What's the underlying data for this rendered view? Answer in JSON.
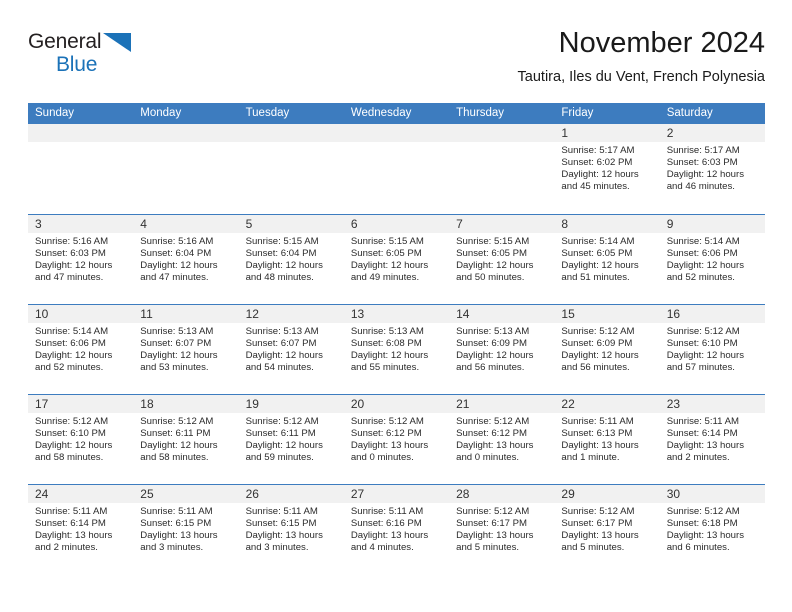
{
  "brand": {
    "name_top": "General",
    "name_bottom": "Blue",
    "triangle_icon": "triangle-icon",
    "color_dark": "#231f20",
    "color_blue": "#1b72b8"
  },
  "header": {
    "title": "November 2024",
    "subtitle": "Tautira, Iles du Vent, French Polynesia"
  },
  "theme": {
    "accent": "#3d7cbf",
    "day_strip": "#f1f1f1",
    "text": "#2b2b2b"
  },
  "calendar": {
    "weekdays": [
      "Sunday",
      "Monday",
      "Tuesday",
      "Wednesday",
      "Thursday",
      "Friday",
      "Saturday"
    ],
    "weeks": [
      [
        {
          "day": "",
          "empty": true
        },
        {
          "day": "",
          "empty": true
        },
        {
          "day": "",
          "empty": true
        },
        {
          "day": "",
          "empty": true
        },
        {
          "day": "",
          "empty": true
        },
        {
          "day": "1",
          "sunrise": "Sunrise: 5:17 AM",
          "sunset": "Sunset: 6:02 PM",
          "daylight1": "Daylight: 12 hours",
          "daylight2": "and 45 minutes."
        },
        {
          "day": "2",
          "sunrise": "Sunrise: 5:17 AM",
          "sunset": "Sunset: 6:03 PM",
          "daylight1": "Daylight: 12 hours",
          "daylight2": "and 46 minutes."
        }
      ],
      [
        {
          "day": "3",
          "sunrise": "Sunrise: 5:16 AM",
          "sunset": "Sunset: 6:03 PM",
          "daylight1": "Daylight: 12 hours",
          "daylight2": "and 47 minutes."
        },
        {
          "day": "4",
          "sunrise": "Sunrise: 5:16 AM",
          "sunset": "Sunset: 6:04 PM",
          "daylight1": "Daylight: 12 hours",
          "daylight2": "and 47 minutes."
        },
        {
          "day": "5",
          "sunrise": "Sunrise: 5:15 AM",
          "sunset": "Sunset: 6:04 PM",
          "daylight1": "Daylight: 12 hours",
          "daylight2": "and 48 minutes."
        },
        {
          "day": "6",
          "sunrise": "Sunrise: 5:15 AM",
          "sunset": "Sunset: 6:05 PM",
          "daylight1": "Daylight: 12 hours",
          "daylight2": "and 49 minutes."
        },
        {
          "day": "7",
          "sunrise": "Sunrise: 5:15 AM",
          "sunset": "Sunset: 6:05 PM",
          "daylight1": "Daylight: 12 hours",
          "daylight2": "and 50 minutes."
        },
        {
          "day": "8",
          "sunrise": "Sunrise: 5:14 AM",
          "sunset": "Sunset: 6:05 PM",
          "daylight1": "Daylight: 12 hours",
          "daylight2": "and 51 minutes."
        },
        {
          "day": "9",
          "sunrise": "Sunrise: 5:14 AM",
          "sunset": "Sunset: 6:06 PM",
          "daylight1": "Daylight: 12 hours",
          "daylight2": "and 52 minutes."
        }
      ],
      [
        {
          "day": "10",
          "sunrise": "Sunrise: 5:14 AM",
          "sunset": "Sunset: 6:06 PM",
          "daylight1": "Daylight: 12 hours",
          "daylight2": "and 52 minutes."
        },
        {
          "day": "11",
          "sunrise": "Sunrise: 5:13 AM",
          "sunset": "Sunset: 6:07 PM",
          "daylight1": "Daylight: 12 hours",
          "daylight2": "and 53 minutes."
        },
        {
          "day": "12",
          "sunrise": "Sunrise: 5:13 AM",
          "sunset": "Sunset: 6:07 PM",
          "daylight1": "Daylight: 12 hours",
          "daylight2": "and 54 minutes."
        },
        {
          "day": "13",
          "sunrise": "Sunrise: 5:13 AM",
          "sunset": "Sunset: 6:08 PM",
          "daylight1": "Daylight: 12 hours",
          "daylight2": "and 55 minutes."
        },
        {
          "day": "14",
          "sunrise": "Sunrise: 5:13 AM",
          "sunset": "Sunset: 6:09 PM",
          "daylight1": "Daylight: 12 hours",
          "daylight2": "and 56 minutes."
        },
        {
          "day": "15",
          "sunrise": "Sunrise: 5:12 AM",
          "sunset": "Sunset: 6:09 PM",
          "daylight1": "Daylight: 12 hours",
          "daylight2": "and 56 minutes."
        },
        {
          "day": "16",
          "sunrise": "Sunrise: 5:12 AM",
          "sunset": "Sunset: 6:10 PM",
          "daylight1": "Daylight: 12 hours",
          "daylight2": "and 57 minutes."
        }
      ],
      [
        {
          "day": "17",
          "sunrise": "Sunrise: 5:12 AM",
          "sunset": "Sunset: 6:10 PM",
          "daylight1": "Daylight: 12 hours",
          "daylight2": "and 58 minutes."
        },
        {
          "day": "18",
          "sunrise": "Sunrise: 5:12 AM",
          "sunset": "Sunset: 6:11 PM",
          "daylight1": "Daylight: 12 hours",
          "daylight2": "and 58 minutes."
        },
        {
          "day": "19",
          "sunrise": "Sunrise: 5:12 AM",
          "sunset": "Sunset: 6:11 PM",
          "daylight1": "Daylight: 12 hours",
          "daylight2": "and 59 minutes."
        },
        {
          "day": "20",
          "sunrise": "Sunrise: 5:12 AM",
          "sunset": "Sunset: 6:12 PM",
          "daylight1": "Daylight: 13 hours",
          "daylight2": "and 0 minutes."
        },
        {
          "day": "21",
          "sunrise": "Sunrise: 5:12 AM",
          "sunset": "Sunset: 6:12 PM",
          "daylight1": "Daylight: 13 hours",
          "daylight2": "and 0 minutes."
        },
        {
          "day": "22",
          "sunrise": "Sunrise: 5:11 AM",
          "sunset": "Sunset: 6:13 PM",
          "daylight1": "Daylight: 13 hours",
          "daylight2": "and 1 minute."
        },
        {
          "day": "23",
          "sunrise": "Sunrise: 5:11 AM",
          "sunset": "Sunset: 6:14 PM",
          "daylight1": "Daylight: 13 hours",
          "daylight2": "and 2 minutes."
        }
      ],
      [
        {
          "day": "24",
          "sunrise": "Sunrise: 5:11 AM",
          "sunset": "Sunset: 6:14 PM",
          "daylight1": "Daylight: 13 hours",
          "daylight2": "and 2 minutes."
        },
        {
          "day": "25",
          "sunrise": "Sunrise: 5:11 AM",
          "sunset": "Sunset: 6:15 PM",
          "daylight1": "Daylight: 13 hours",
          "daylight2": "and 3 minutes."
        },
        {
          "day": "26",
          "sunrise": "Sunrise: 5:11 AM",
          "sunset": "Sunset: 6:15 PM",
          "daylight1": "Daylight: 13 hours",
          "daylight2": "and 3 minutes."
        },
        {
          "day": "27",
          "sunrise": "Sunrise: 5:11 AM",
          "sunset": "Sunset: 6:16 PM",
          "daylight1": "Daylight: 13 hours",
          "daylight2": "and 4 minutes."
        },
        {
          "day": "28",
          "sunrise": "Sunrise: 5:12 AM",
          "sunset": "Sunset: 6:17 PM",
          "daylight1": "Daylight: 13 hours",
          "daylight2": "and 5 minutes."
        },
        {
          "day": "29",
          "sunrise": "Sunrise: 5:12 AM",
          "sunset": "Sunset: 6:17 PM",
          "daylight1": "Daylight: 13 hours",
          "daylight2": "and 5 minutes."
        },
        {
          "day": "30",
          "sunrise": "Sunrise: 5:12 AM",
          "sunset": "Sunset: 6:18 PM",
          "daylight1": "Daylight: 13 hours",
          "daylight2": "and 6 minutes."
        }
      ]
    ]
  }
}
